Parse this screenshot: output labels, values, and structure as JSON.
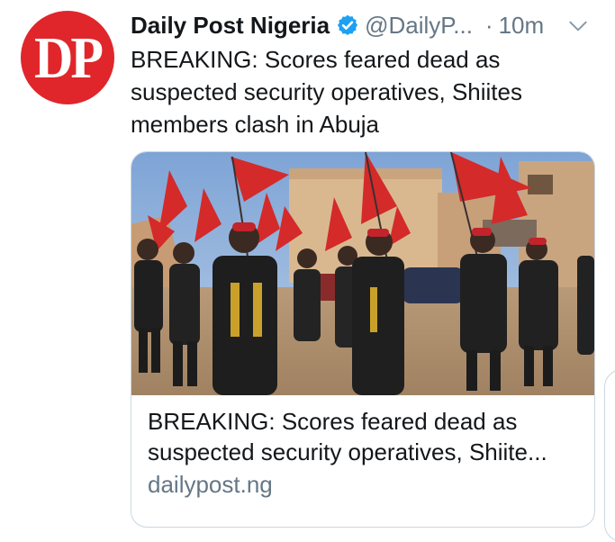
{
  "colors": {
    "avatar_bg": "#e0262b",
    "verified_badge": "#1da1f2",
    "secondary_text": "#657786",
    "primary_text": "#14171a",
    "border": "#ccd6dd"
  },
  "tweet": {
    "avatar_text": "DP",
    "author_name": "Daily Post Nigeria",
    "verified_icon": "verified-badge-icon",
    "handle": "@DailyP...",
    "separator": "·",
    "time": "10m",
    "menu_icon": "chevron-down-icon",
    "text": "BREAKING: Scores feared dead as suspected security operatives, Shiites members clash in Abuja"
  },
  "card": {
    "image_icon": "news-photo",
    "title": "BREAKING: Scores feared dead as suspected security operatives, Shiite...",
    "domain": "dailypost.ng"
  }
}
